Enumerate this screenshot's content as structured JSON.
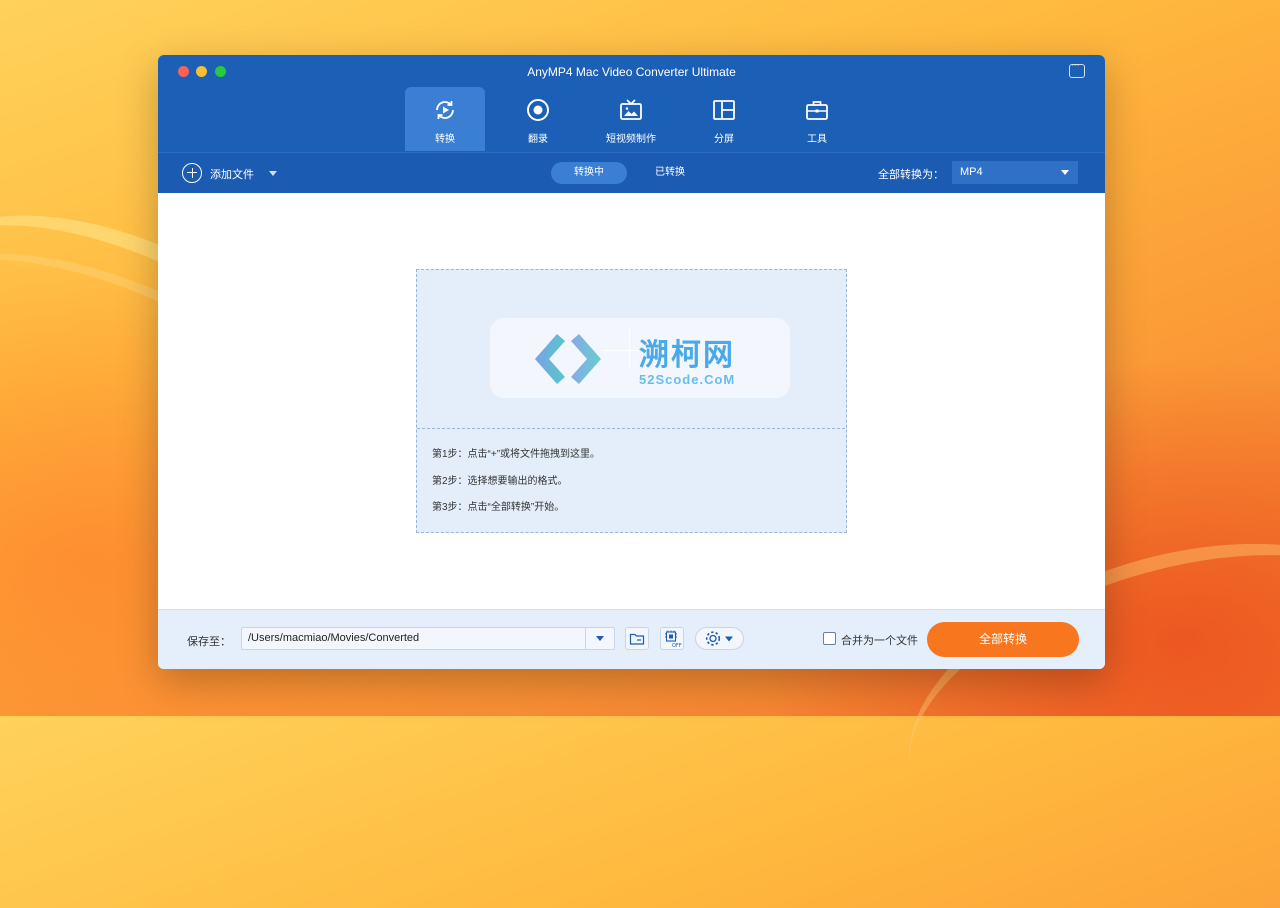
{
  "window": {
    "title": "AnyMP4 Mac Video Converter Ultimate"
  },
  "tabs": [
    {
      "label": "转换",
      "icon": "convert-icon",
      "active": true
    },
    {
      "label": "翻录",
      "icon": "record-disc-icon",
      "active": false
    },
    {
      "label": "短视频制作",
      "icon": "tv-icon",
      "active": false
    },
    {
      "label": "分屏",
      "icon": "split-screen-icon",
      "active": false
    },
    {
      "label": "工具",
      "icon": "toolbox-icon",
      "active": false
    }
  ],
  "toolbar": {
    "add_file_label": "添加文件",
    "segment_converting": "转换中",
    "segment_converted": "已转换",
    "convert_all_to_label": "全部转换为：",
    "format_value": "MP4"
  },
  "dropzone": {
    "logo_cn": "溯柯网",
    "logo_en": "52Scode.CoM",
    "steps": [
      "第1步：点击“+”或将文件拖拽到这里。",
      "第2步：选择想要输出的格式。",
      "第3步：点击“全部转换”开始。"
    ]
  },
  "footer": {
    "save_to_label": "保存至：",
    "path_value": "/Users/macmiao/Movies/Converted",
    "hw_badge": "OFF",
    "merge_label": "合并为一个文件",
    "merge_checked": false,
    "convert_all_button": "全部转换"
  },
  "colors": {
    "header_blue": "#1c5fb6",
    "active_tab": "#3a7fd3",
    "convert_button": "#f7761e",
    "dropzone_bg": "#e4eefb"
  }
}
